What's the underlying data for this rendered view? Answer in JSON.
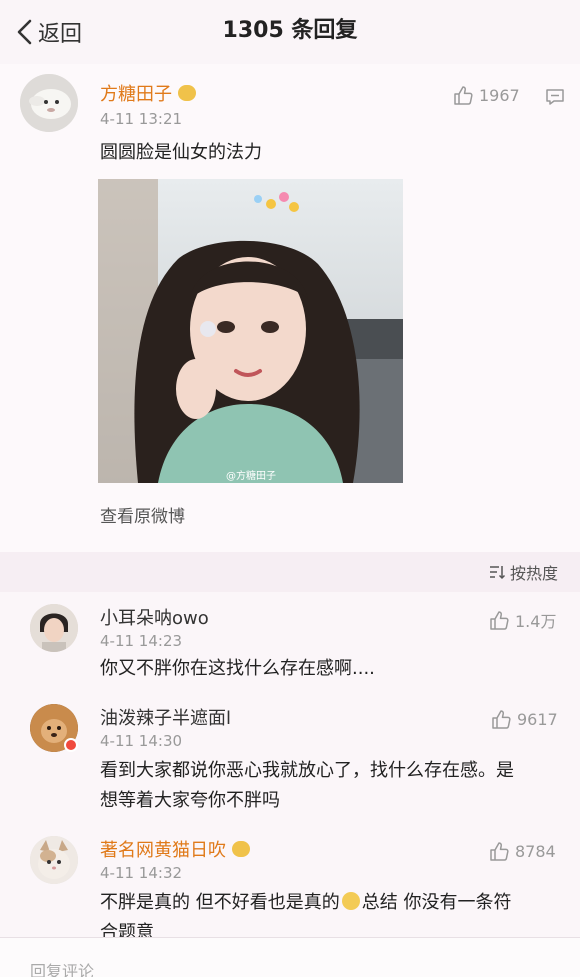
{
  "header": {
    "back_label": "返回",
    "title": "1305 条回复"
  },
  "post": {
    "author": "方糖田子",
    "time": "4-11 13:21",
    "likes": "1967",
    "text": "圆圆脸是仙女的法力",
    "photo_watermark": "@方糖田子",
    "view_original": "查看原微博"
  },
  "sort": {
    "label": "按热度"
  },
  "replies": [
    {
      "author": "小耳朵呐owo",
      "time": "4-11 14:23",
      "likes": "1.4万",
      "text": "你又不胖你在这找什么存在感啊...."
    },
    {
      "author": "油泼辣子半遮面l",
      "time": "4-11 14:30",
      "likes": "9617",
      "text_line1": "看到大家都说你恶心我就放心了，找什么存在感。是",
      "text_line2": "想等着大家夸你不胖吗"
    },
    {
      "author": "著名网黄猫日吹",
      "time": "4-11 14:32",
      "likes": "8784",
      "text_line1": "不胖是真的 但不好看也是真的",
      "text_line1b": "总结 你没有一条符",
      "text_line2": "合题意"
    }
  ],
  "bottom": {
    "placeholder": "回复评论"
  },
  "colors": {
    "author_name": "#e07a1a",
    "background": "#f6eef3"
  }
}
